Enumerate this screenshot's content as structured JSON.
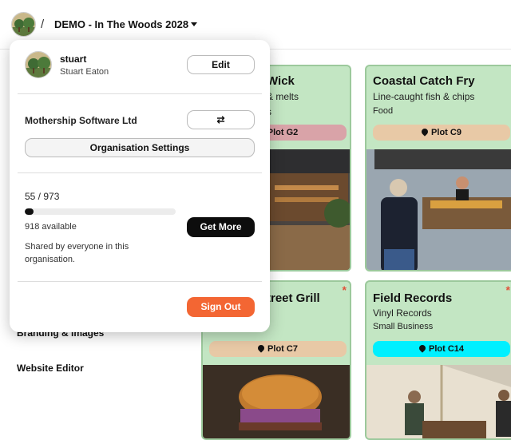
{
  "header": {
    "separator": "/",
    "event_title": "DEMO - In The Woods 2028"
  },
  "sidebar": {
    "items": [
      {
        "label": "Branding & Images"
      },
      {
        "label": "Website Editor"
      }
    ]
  },
  "cards": [
    {
      "title": "Wick",
      "subtitle": "& melts",
      "category": "s",
      "plot": "Plot G2",
      "plot_color": "#d9a3a8"
    },
    {
      "title": "Coastal Catch Fry",
      "subtitle": "Line-caught fish & chips",
      "category": "Food",
      "plot": "Plot C9",
      "plot_color": "#e8c9a6"
    },
    {
      "title": "treet Grill",
      "subtitle": "",
      "category": "",
      "plot": "Plot C7",
      "plot_color": "#e8c9a6",
      "starred": "*"
    },
    {
      "title": "Field Records",
      "subtitle": "Vinyl Records",
      "category": "Small Business",
      "plot": "Plot C14",
      "plot_color": "#00f0ff",
      "starred": "*"
    }
  ],
  "popover": {
    "user": {
      "username": "stuart",
      "full_name": "Stuart Eaton",
      "edit_label": "Edit"
    },
    "organisation": {
      "name": "Mothership Software Ltd",
      "switch_icon": "⇄",
      "settings_label": "Organisation Settings"
    },
    "credits": {
      "used": "55 / 973",
      "progress_fraction": 0.0565,
      "available": "918 available",
      "get_more_label": "Get More",
      "shared_note": "Shared by everyone in this organisation."
    },
    "sign_out_label": "Sign Out"
  },
  "colors": {
    "accent_orange": "#f36633",
    "card_green": "#c3e6c3",
    "dark_button": "#0d0d0d"
  }
}
